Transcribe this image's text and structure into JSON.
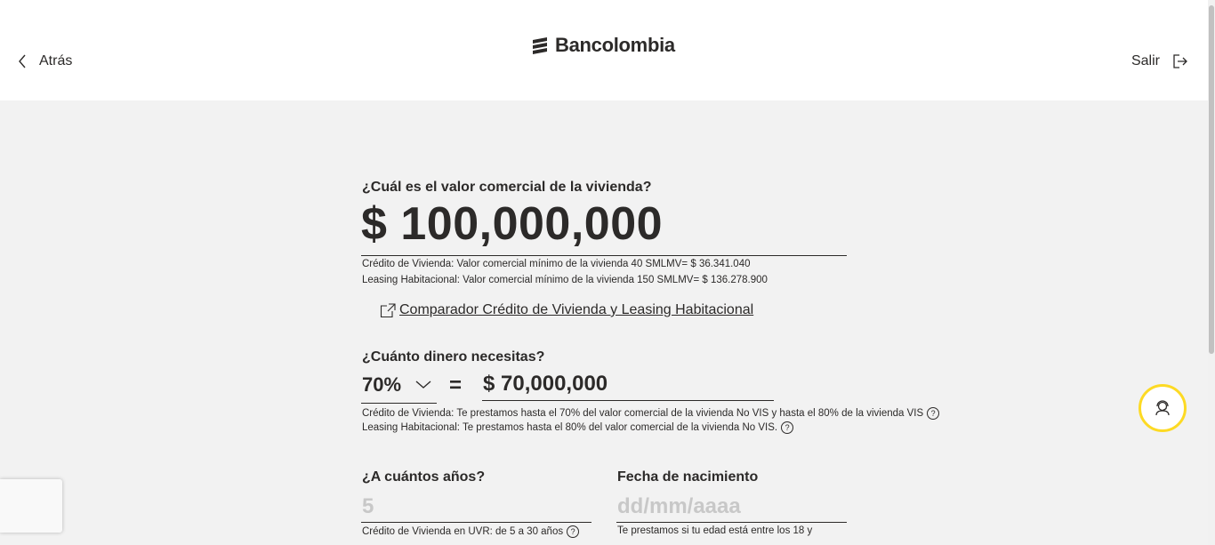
{
  "header": {
    "back_label": "Atrás",
    "brand": "Bancolombia",
    "exit_label": "Salir"
  },
  "property_value": {
    "question": "¿Cuál es el valor comercial de la vivienda?",
    "value": "$ 100,000,000",
    "note_credit": "Crédito de Vivienda: Valor comercial mínimo de la vivienda 40 SMLMV= $ 36.341.040",
    "note_leasing": "Leasing Habitacional: Valor comercial mínimo de la vivienda 150 SMLMV= $ 136.278.900"
  },
  "comparator_link": " Comparador Crédito de Vivienda y Leasing Habitacional",
  "loan_amount": {
    "question": "¿Cuánto dinero necesitas?",
    "percent": "70%",
    "equals": "=",
    "amount": "$ 70,000,000",
    "note_credit": "Crédito de Vivienda: Te prestamos hasta el 70% del valor comercial de la vivienda No VIS y hasta el 80% de la vivienda VIS",
    "note_leasing": "Leasing Habitacional: Te prestamos hasta el 80% del valor comercial de la vivienda No VIS."
  },
  "term": {
    "question": "¿A cuántos años?",
    "placeholder": "5",
    "note_credit": "Crédito de Vivienda en UVR: de 5 a 30 años"
  },
  "birth_date": {
    "label": "Fecha de nacimiento",
    "placeholder": "dd/mm/aaaa",
    "note": "Te prestamos si tu edad está entre los 18 y"
  },
  "help_glyph": "?",
  "colors": {
    "accent": "#fdda24",
    "text": "#2c2a29",
    "background": "#f2f2f2"
  },
  "icons": {
    "back": "chevron-left-icon",
    "exit": "logout-icon",
    "link": "external-link-icon",
    "dropdown": "chevron-down-icon",
    "chat": "support-agent-icon"
  }
}
